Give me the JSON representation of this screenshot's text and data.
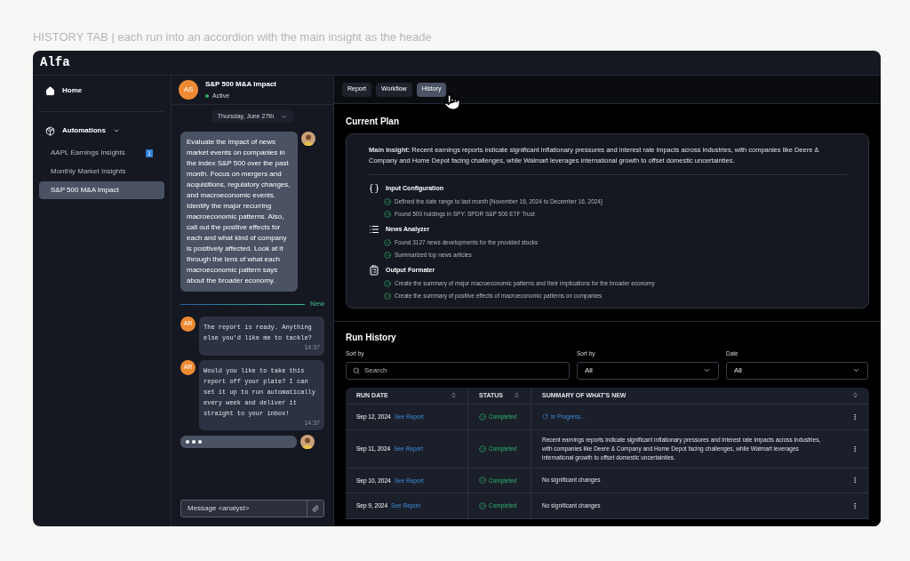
{
  "caption": "HISTORY TAB | each run into an accordion with the main insight as the heade",
  "app": {
    "logo": "Alfa"
  },
  "sidebar": {
    "home": {
      "label": "Home",
      "selected": false
    },
    "section": {
      "label": "Automations",
      "expanded": true,
      "items": [
        {
          "label": "AAPL Earnings Insights",
          "badge": "1",
          "selected": false
        },
        {
          "label": "Monthly Market Insights",
          "selected": false
        },
        {
          "label": "S&P 500 M&A Impact",
          "selected": true
        }
      ]
    }
  },
  "chat": {
    "initials": "AS",
    "title": "S&P 500 M&A Impact",
    "status": "Active",
    "date": "Thursday, June 27th",
    "messages": [
      {
        "kind": "user",
        "text": "Evaluate the impact of news market events on companies in the index S&P 500 over the past month. Focus on mergers and acquisitions, regulatory changes, and macroeconomic events. Identify the major recurring macroeconomic patterns. Also, call out the positive effects for each and what kind of company is positively affected. Look at it through the lens of what each macroeconomic pattern says about the broader economy."
      },
      {
        "kind": "divider",
        "text": "New"
      },
      {
        "kind": "agent",
        "initials": "AR",
        "text": "The report is ready. Anything else you'd like me to tackle?",
        "time": "14:37"
      },
      {
        "kind": "agent",
        "initials": "AR",
        "text": "Would you like to take this report off your plate? I can set it up to run automatically every week and deliver it straight to your inbox!",
        "time": "14:37"
      },
      {
        "kind": "typing"
      }
    ],
    "input": {
      "placeholder": "Message <analyst>"
    }
  },
  "tabs": [
    {
      "label": "Report",
      "selected": false
    },
    {
      "label": "Workflow",
      "selected": false
    },
    {
      "label": "History",
      "selected": true
    }
  ],
  "current_plan": {
    "title": "Current Plan",
    "main_insight": "**Main insight:** Recent earnings reports indicate significant inflationary pressures and interest rate impacts across industries, with companies like Deere & Company and Home Depot facing challenges, while Walmart leverages international growth to offset domestic uncertainties.",
    "steps": [
      {
        "kind": "braces",
        "title": "Input Configuration",
        "items": [
          {
            "text": "Defined the date range to last month [November 16, 2024 to December 16, 2024]",
            "done": true
          },
          {
            "text": "Found 500 holdings in SPY: SPDR S&P 500 ETF Trust",
            "done": true
          }
        ]
      },
      {
        "kind": "list",
        "title": "News Analyzer",
        "items": [
          {
            "text": "Found 3127 news developments for the provided stocks",
            "done": true
          },
          {
            "text": "Summarized top news articles",
            "done": true
          }
        ]
      },
      {
        "kind": "clipboard",
        "title": "Output Formater",
        "items": [
          {
            "text": "Create the summary of major macroeconomic patterns and their implications for the broader economy",
            "done": true
          },
          {
            "text": "Create the summary of positive effects of macroeconomic patterns on companies",
            "done": true
          }
        ]
      }
    ]
  },
  "run_history": {
    "title": "Run History",
    "filters": [
      {
        "kind": "search",
        "label": "Sort by",
        "placeholder": "Search"
      },
      {
        "kind": "select",
        "label": "Sort by",
        "value": "All"
      },
      {
        "kind": "select",
        "label": "Date",
        "value": "All"
      }
    ],
    "columns": [
      "RUN DATE",
      "STATUS",
      "SUMMARY OF WHAT'S NEW"
    ],
    "rows": [
      {
        "date": "Sep 12, 2024",
        "link": "See Report",
        "status": "Completed",
        "in_progress": true,
        "summary": "In Progress..."
      },
      {
        "date": "Sep 11, 2024",
        "link": "See Report",
        "status": "Completed",
        "in_progress": false,
        "summary": "Recent earnings reports indicate significant inflationary pressures and interest rate impacts across industries, with companies like Deere & Company and Home Depot facing challenges, while Walmart leverages international growth to offset domestic uncertainties."
      },
      {
        "date": "Sep 10, 2024",
        "link": "See Report",
        "status": "Completed",
        "in_progress": false,
        "summary": "No significant changes"
      },
      {
        "date": "Sep 9, 2024",
        "link": "See Report",
        "status": "Completed",
        "in_progress": false,
        "summary": "No significant changes"
      }
    ]
  }
}
